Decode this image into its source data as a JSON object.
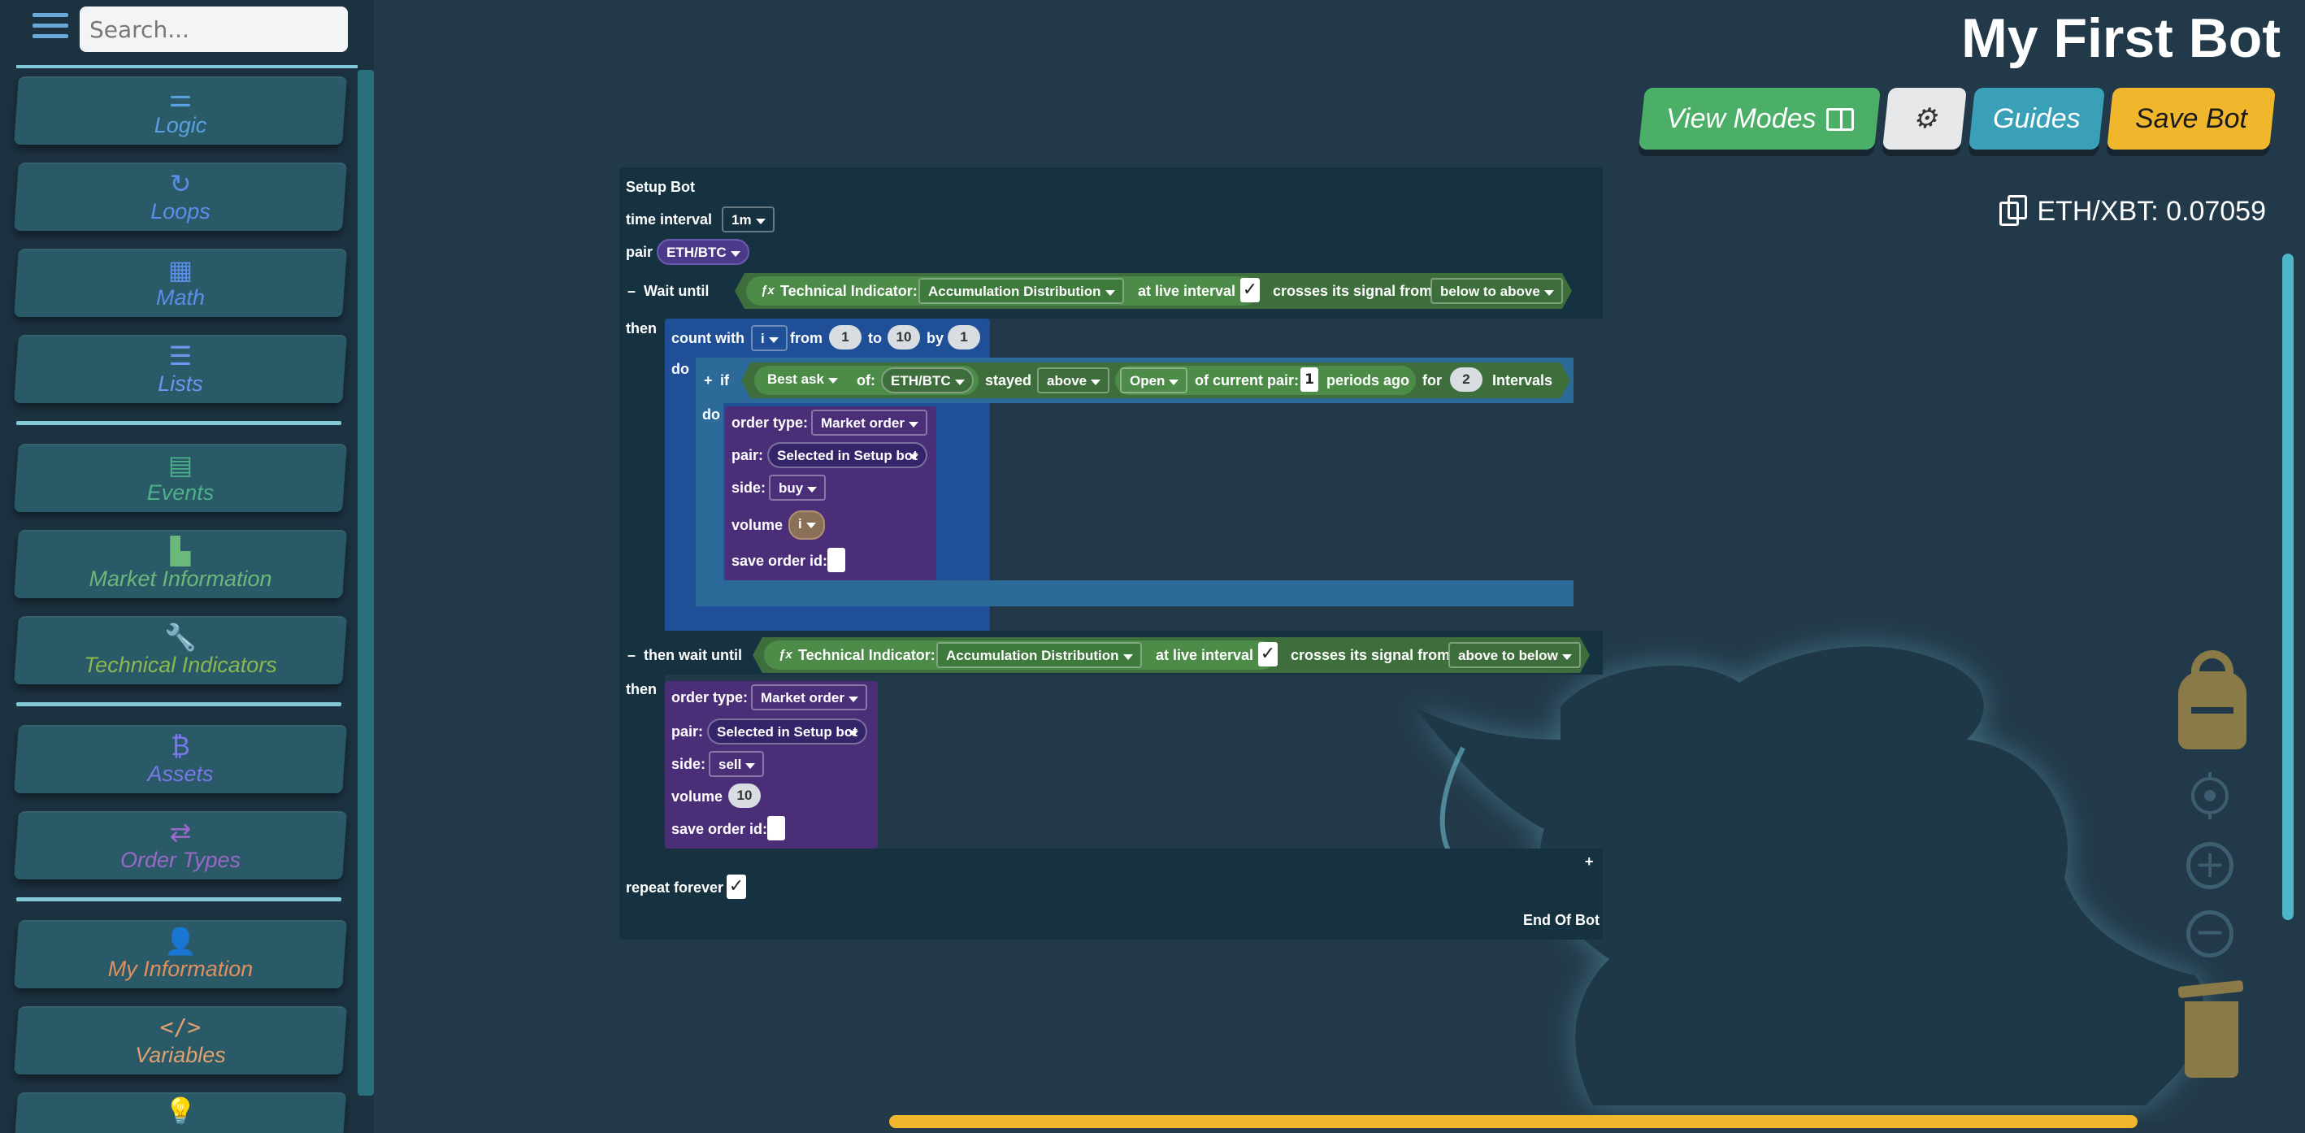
{
  "sidebar": {
    "search_placeholder": "Search...",
    "categories": [
      {
        "label": "Logic",
        "icon": "⚌",
        "color": "#5aa0e0"
      },
      {
        "label": "Loops",
        "icon": "↻",
        "color": "#5a8ee8"
      },
      {
        "label": "Math",
        "icon": "▦",
        "color": "#5a8ee8"
      },
      {
        "label": "Lists",
        "icon": "☰",
        "color": "#6a98f0"
      },
      {
        "label": "Events",
        "icon": "▤",
        "color": "#4cb08a"
      },
      {
        "label": "Market Information",
        "icon": "▙",
        "color": "#6ab87a"
      },
      {
        "label": "Technical Indicators",
        "icon": "🔧",
        "color": "#8ab850"
      },
      {
        "label": "Assets",
        "icon": "₿",
        "color": "#7a78e8"
      },
      {
        "label": "Order Types",
        "icon": "⇄",
        "color": "#9a68c8"
      },
      {
        "label": "My Information",
        "icon": "👤",
        "color": "#e09060"
      },
      {
        "label": "Variables",
        "icon": "</>",
        "color": "#e0a070"
      },
      {
        "label": "",
        "icon": "💡",
        "color": "#e0b080"
      }
    ]
  },
  "header": {
    "title": "My First Bot",
    "view_modes": "View Modes",
    "guides": "Guides",
    "save_bot": "Save Bot",
    "pair_price": "ETH/XBT: 0.07059"
  },
  "setup": {
    "title": "Setup Bot",
    "time_interval_label": "time interval",
    "time_interval_value": "1m",
    "pair_label": "pair",
    "pair_value": "ETH/BTC",
    "collapse_sign": "–",
    "wait_until": "Wait until",
    "then": "then",
    "do": "do",
    "fx": "ƒx",
    "ti_label": "Technical Indicator:",
    "ti_value": "Accumulation Distribution",
    "at_live_interval": "at live interval",
    "check": "✓",
    "crosses": "crosses its signal from",
    "below_to_above": "below to above",
    "count_with": "count with",
    "var_i": "i",
    "from": "from",
    "from_val": "1",
    "to": "to",
    "to_val": "10",
    "by": "by",
    "by_val": "1",
    "plus": "+",
    "if": "if",
    "best_ask": "Best ask",
    "of": "of:",
    "of_pair": "ETH/BTC",
    "stayed": "stayed",
    "above": "above",
    "open": "Open",
    "of_current_pair": "of current pair:",
    "periods_val": "1",
    "periods_ago": "periods ago",
    "for": "for",
    "for_val": "2",
    "intervals": "Intervals",
    "order_type_label": "order type:",
    "order_type_value": "Market order",
    "pair_order_label": "pair:",
    "pair_order_value": "Selected in Setup bot",
    "side_label": "side:",
    "side_buy": "buy",
    "side_sell": "sell",
    "volume_label": "volume",
    "volume_var": "i",
    "volume_val": "10",
    "save_order_label": "save order id:",
    "then_wait_until": "then wait until",
    "above_to_below": "above to below",
    "repeat_forever": "repeat forever",
    "end_of_bot": "End Of Bot"
  }
}
